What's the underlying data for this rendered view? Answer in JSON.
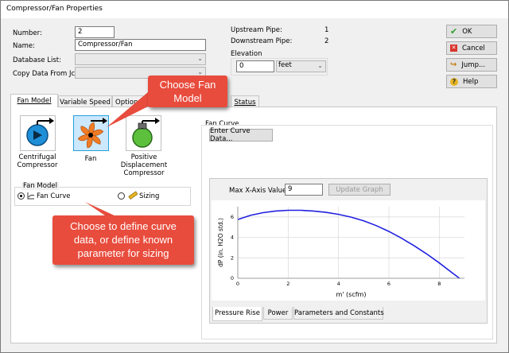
{
  "window": {
    "title": "Compressor/Fan Properties"
  },
  "form": {
    "number_label": "Number:",
    "number_value": "2",
    "name_label": "Name:",
    "name_value": "Compressor/Fan",
    "database_label": "Database List:",
    "database_value": "",
    "copy_label": "Copy Data From Jct...",
    "copy_value": ""
  },
  "pipes": {
    "upstream_label": "Upstream Pipe:",
    "upstream_value": "1",
    "downstream_label": "Downstream Pipe:",
    "downstream_value": "2"
  },
  "elevation": {
    "label": "Elevation",
    "value": "0",
    "unit": "feet"
  },
  "buttons": {
    "ok": "OK",
    "cancel": "Cancel",
    "jump": "Jump...",
    "help": "Help"
  },
  "tabs": [
    {
      "label": "Fan Model",
      "active": true
    },
    {
      "label": "Variable Speed",
      "active": false
    },
    {
      "label": "Optional",
      "active": false
    },
    {
      "label": "Status",
      "active": false
    }
  ],
  "callouts": {
    "choose_model": "Choose Fan Model",
    "choose_define": "Choose to define curve data, or define known parameter for sizing"
  },
  "models": [
    {
      "label": "Centrifugal Compressor",
      "icon": "centrifugal-compressor-icon",
      "selected": false
    },
    {
      "label": "Fan",
      "icon": "fan-icon",
      "selected": true
    },
    {
      "label": "Positive Displacement Compressor",
      "icon": "positive-displacement-compressor-icon",
      "selected": false
    }
  ],
  "fan_model_group": {
    "title": "Fan Model",
    "options": [
      {
        "label": "Fan Curve",
        "selected": true
      },
      {
        "label": "Sizing",
        "selected": false
      }
    ]
  },
  "fan_curve": {
    "title": "Fan Curve",
    "enter_button": "Enter Curve Data...",
    "max_x_label": "Max X-Axis Value:",
    "max_x_value": "9",
    "update_button": "Update Graph"
  },
  "bottom_tabs": [
    {
      "label": "Pressure Rise",
      "active": true
    },
    {
      "label": "Power",
      "active": false
    },
    {
      "label": "Parameters and Constants",
      "active": false
    }
  ],
  "colors": {
    "accent_red": "#e84c3d",
    "curve_blue": "#2020e0",
    "selection_blue": "#cce8ff"
  },
  "chart_data": {
    "type": "line",
    "xlabel": "m' (scfm)",
    "ylabel": "dP (in. H2O std.)",
    "xlim": [
      0,
      9
    ],
    "ylim": [
      0,
      7
    ],
    "xticks": [
      0,
      2,
      4,
      6,
      8
    ],
    "yticks": [
      0,
      2,
      4,
      6
    ],
    "grid": true,
    "series": [
      {
        "x": [
          0,
          0.5,
          1,
          1.5,
          2,
          2.5,
          3,
          3.5,
          4,
          4.5,
          5,
          5.5,
          6,
          6.5,
          7,
          7.5,
          8,
          8.5,
          8.8
        ],
        "y": [
          5.75,
          6.15,
          6.42,
          6.58,
          6.65,
          6.65,
          6.58,
          6.45,
          6.25,
          5.98,
          5.62,
          5.15,
          4.58,
          3.92,
          3.18,
          2.38,
          1.5,
          0.55,
          0.0
        ]
      }
    ]
  }
}
